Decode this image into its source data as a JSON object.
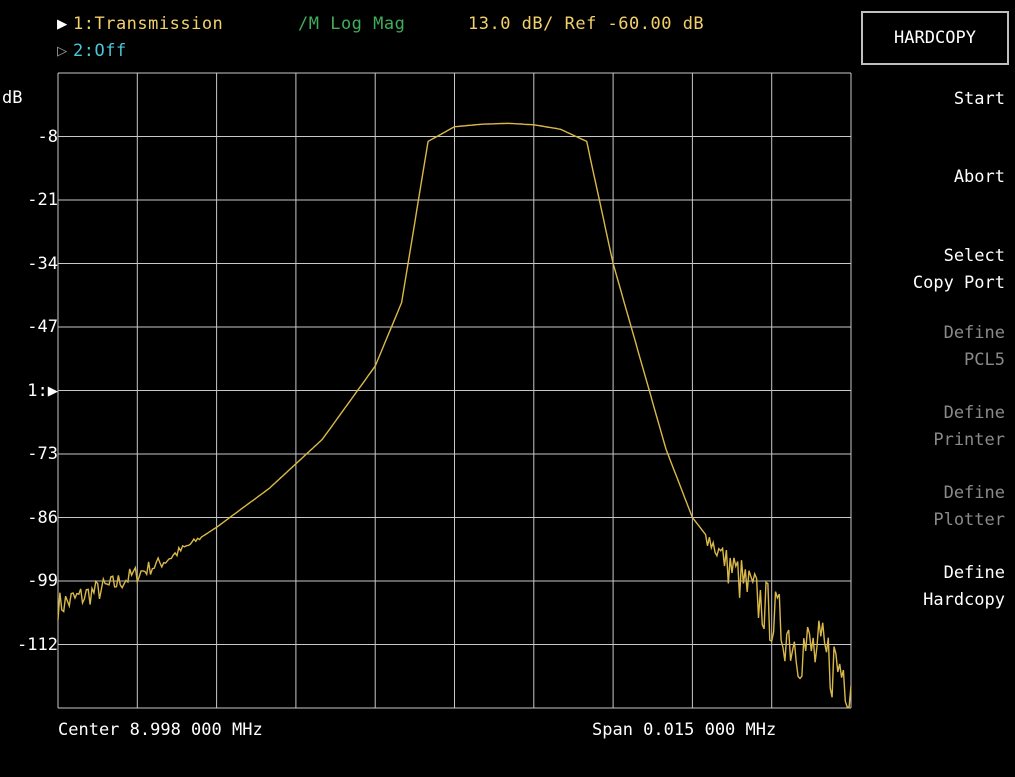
{
  "header": {
    "trace1_marker": "▶",
    "trace1_label": "1:Transmission",
    "trace1_format": "/M Log Mag",
    "trace1_scale": "13.0 dB/ Ref -60.00 dB",
    "trace2_marker": "▷",
    "trace2_label": "2:Off"
  },
  "chart_data": {
    "type": "line",
    "ylabel": "dB",
    "y_ticks": [
      "-8",
      "-21",
      "-34",
      "-47",
      "1:▶",
      "-73",
      "-86",
      "-99",
      "-112"
    ],
    "ylim": [
      -125,
      5
    ],
    "xlim": [
      8.9905,
      9.0055
    ],
    "x_unit": "MHz",
    "grid": true,
    "series": [
      {
        "color": "#d9b84a",
        "x": [
          8.9905,
          8.9915,
          8.9925,
          8.9935,
          8.9945,
          8.9955,
          8.9965,
          8.997,
          8.9975,
          8.998,
          8.9985,
          8.999,
          8.9995,
          9.0,
          9.0005,
          9.001,
          9.0015,
          9.002,
          9.0025,
          9.0035,
          9.0045,
          9.0055
        ],
        "y": [
          -104,
          -100,
          -95,
          -88,
          -80,
          -70,
          -55,
          -42,
          -9,
          -6,
          -5.5,
          -5.3,
          -5.6,
          -6.5,
          -9,
          -34,
          -53,
          -72,
          -86,
          -100,
          -112,
          -118
        ]
      }
    ]
  },
  "footer": {
    "center": "Center 8.998 000 MHz",
    "span": "Span 0.015 000 MHz"
  },
  "softkeys": {
    "title": "HARDCOPY",
    "items": [
      {
        "line1": "Start",
        "line2": ""
      },
      {
        "line1": "Abort",
        "line2": ""
      },
      {
        "line1": "Select",
        "line2": "Copy Port"
      },
      {
        "line1": "Define",
        "line2": "PCL5"
      },
      {
        "line1": "Define",
        "line2": "Printer"
      },
      {
        "line1": "Define",
        "line2": "Plotter"
      },
      {
        "line1": "Define",
        "line2": "Hardcopy"
      }
    ]
  }
}
